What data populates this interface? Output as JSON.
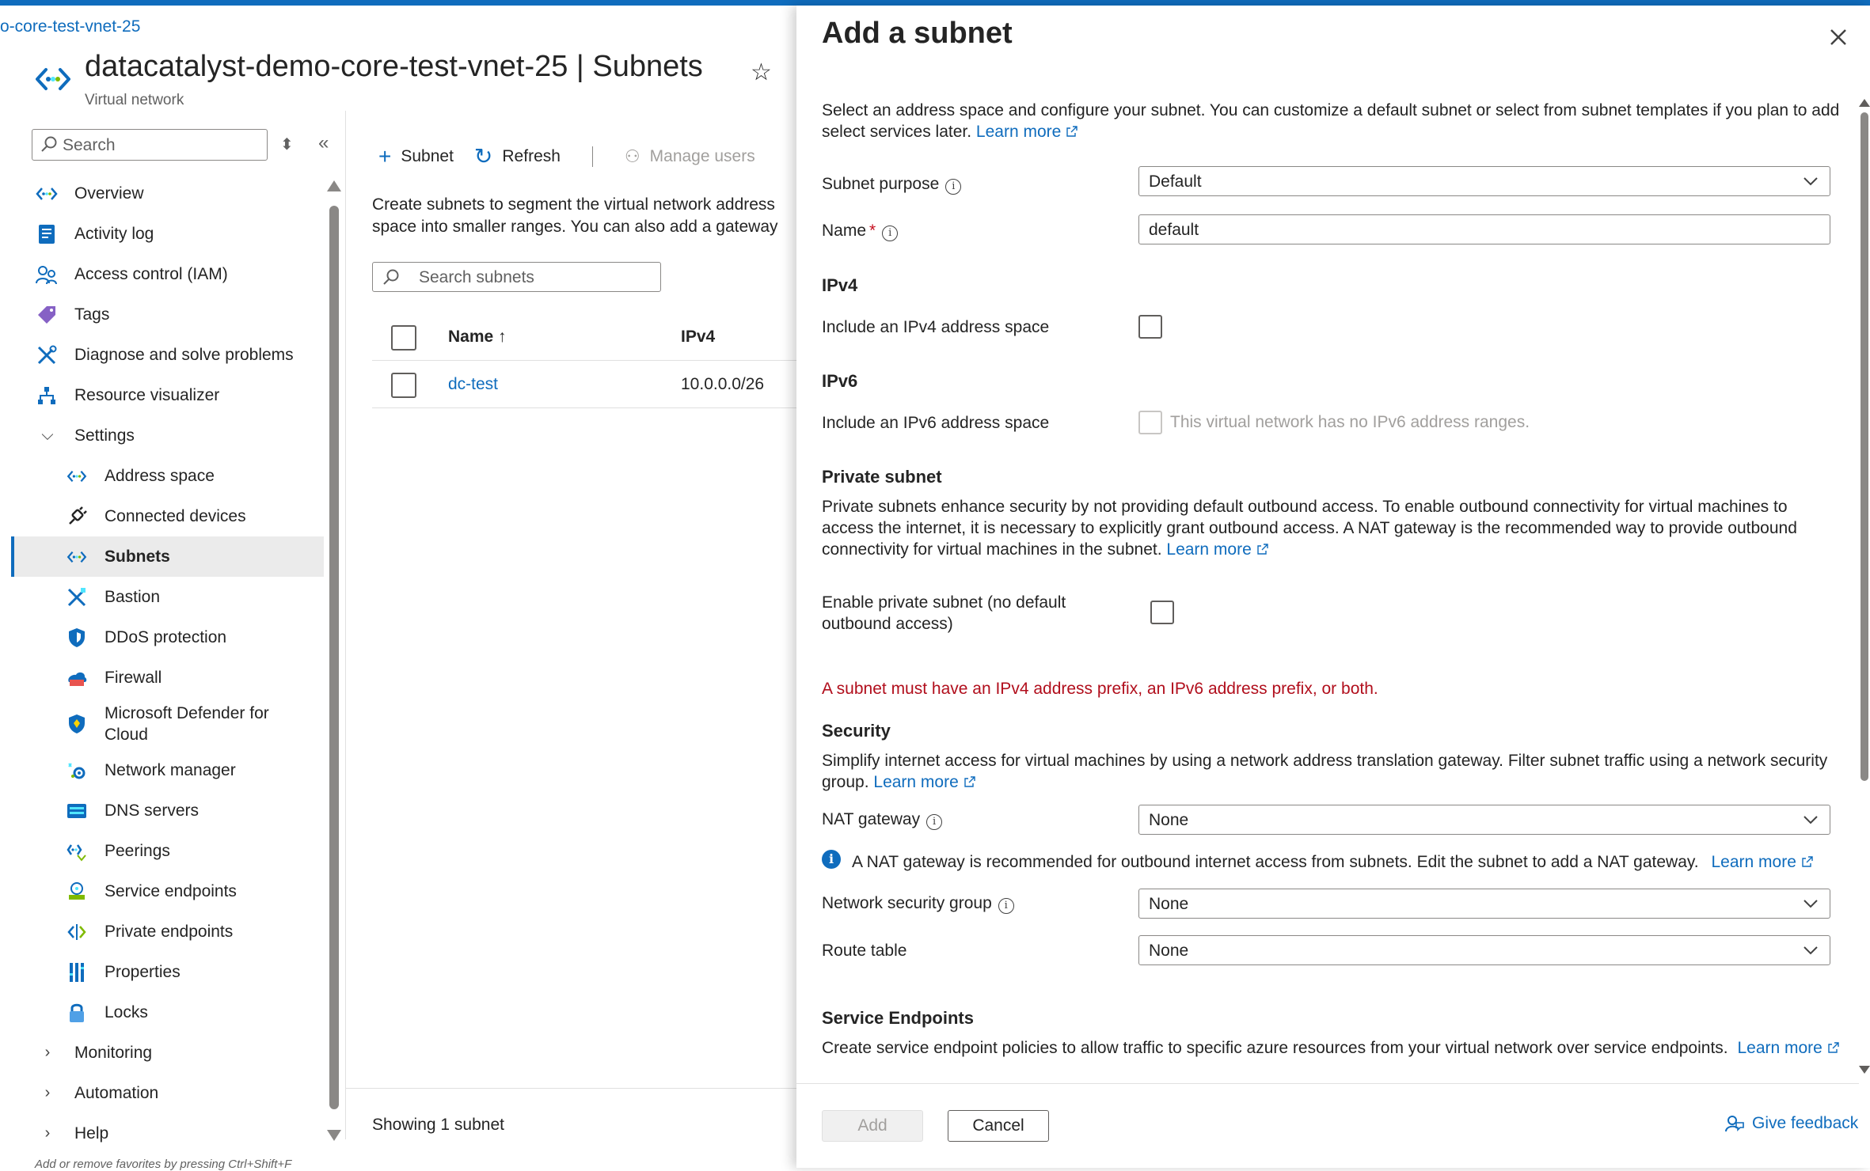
{
  "breadcrumb": "o-core-test-vnet-25",
  "page": {
    "title": "datacatalyst-demo-core-test-vnet-25 | Subnets",
    "subtitle": "Virtual network"
  },
  "sidebar": {
    "search_placeholder": "Search",
    "items": [
      {
        "label": "Overview",
        "icon": "vnet-icon"
      },
      {
        "label": "Activity log",
        "icon": "activity-log-icon"
      },
      {
        "label": "Access control (IAM)",
        "icon": "iam-icon"
      },
      {
        "label": "Tags",
        "icon": "tag-icon"
      },
      {
        "label": "Diagnose and solve problems",
        "icon": "wrench-icon"
      },
      {
        "label": "Resource visualizer",
        "icon": "visualizer-icon"
      }
    ],
    "settings_label": "Settings",
    "settings_items": [
      {
        "label": "Address space",
        "icon": "vnet-icon"
      },
      {
        "label": "Connected devices",
        "icon": "plug-icon"
      },
      {
        "label": "Subnets",
        "icon": "vnet-icon",
        "active": true
      },
      {
        "label": "Bastion",
        "icon": "bastion-icon"
      },
      {
        "label": "DDoS protection",
        "icon": "shield-icon"
      },
      {
        "label": "Firewall",
        "icon": "firewall-icon"
      },
      {
        "label": "Microsoft Defender for Cloud",
        "icon": "defender-icon"
      },
      {
        "label": "Network manager",
        "icon": "network-manager-icon"
      },
      {
        "label": "DNS servers",
        "icon": "dns-icon"
      },
      {
        "label": "Peerings",
        "icon": "peering-icon"
      },
      {
        "label": "Service endpoints",
        "icon": "service-endpoint-icon"
      },
      {
        "label": "Private endpoints",
        "icon": "private-endpoint-icon"
      },
      {
        "label": "Properties",
        "icon": "properties-icon"
      },
      {
        "label": "Locks",
        "icon": "lock-icon"
      }
    ],
    "groups": [
      "Monitoring",
      "Automation",
      "Help"
    ],
    "favorites_hint": "Add or remove favorites by pressing Ctrl+Shift+F"
  },
  "toolbar": {
    "subnet_label": "Subnet",
    "refresh_label": "Refresh",
    "manage_users_label": "Manage users"
  },
  "content": {
    "description": "Create subnets to segment the virtual network address space into smaller ranges. You can also add a gateway subnet.",
    "search_placeholder": "Search subnets",
    "columns": [
      "Name ↑",
      "IPv4"
    ],
    "rows": [
      {
        "name": "dc-test",
        "ipv4": "10.0.0.0/26"
      }
    ],
    "showing": "Showing 1 subnet"
  },
  "panel": {
    "title": "Add a subnet",
    "intro": "Select an address space and configure your subnet. You can customize a default subnet or select from subnet templates if you plan to add select services later.",
    "learn_more": "Learn more",
    "subnet_purpose_label": "Subnet purpose",
    "subnet_purpose_value": "Default",
    "name_label": "Name",
    "name_required": "*",
    "name_value": "default",
    "ipv4_heading": "IPv4",
    "ipv4_include_label": "Include an IPv4 address space",
    "ipv6_heading": "IPv6",
    "ipv6_include_label": "Include an IPv6 address space",
    "ipv6_note": "This virtual network has no IPv6 address ranges.",
    "private_heading": "Private subnet",
    "private_desc": "Private subnets enhance security by not providing default outbound access. To enable outbound connectivity for virtual machines to access the internet, it is necessary to explicitly grant outbound access. A NAT gateway is the recommended way to provide outbound connectivity for virtual machines in the subnet.",
    "private_enable_label": "Enable private subnet (no default outbound access)",
    "error": "A subnet must have an IPv4 address prefix, an IPv6 address prefix, or both.",
    "security_heading": "Security",
    "security_desc": "Simplify internet access for virtual machines by using a network address translation gateway. Filter subnet traffic using a network security group.",
    "nat_label": "NAT gateway",
    "nat_value": "None",
    "nat_info": "A NAT gateway is recommended for outbound internet access from subnets. Edit the subnet to add a NAT gateway.",
    "nsg_label": "Network security group",
    "nsg_value": "None",
    "route_label": "Route table",
    "route_value": "None",
    "endpoints_heading": "Service Endpoints",
    "endpoints_desc": "Create service endpoint policies to allow traffic to specific azure resources from your virtual network over service endpoints.",
    "add_label": "Add",
    "cancel_label": "Cancel",
    "feedback_label": "Give feedback"
  },
  "colors": {
    "accent": "#0f6cbd",
    "error": "#b10e1c",
    "text": "#242424"
  }
}
